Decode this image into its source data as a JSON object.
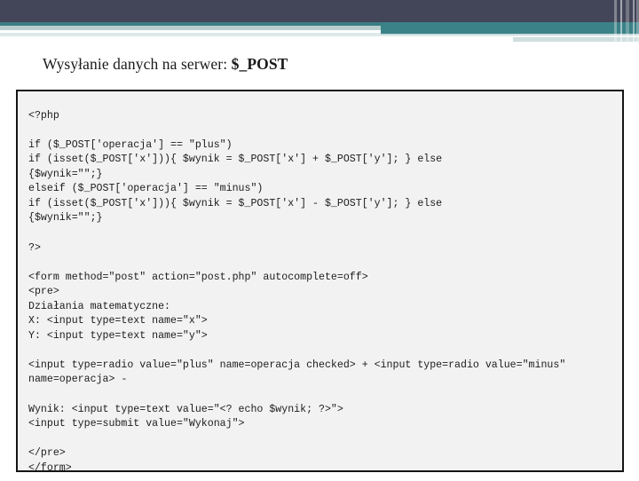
{
  "slide": {
    "title_prefix": "Wysyłanie danych na serwer: ",
    "title_accent": "$_POST",
    "theme": {
      "header_navy": "#434559",
      "header_teal": "#3b8288",
      "header_pale": "#b9cdcd",
      "code_background": "#f2f2f2",
      "code_border": "#151515",
      "code_text": "#1c1c1c",
      "slide_background": "#ffffff"
    }
  },
  "code_block": {
    "language": "php",
    "content": "<?php\n\nif ($_POST['operacja'] == \"plus\")\nif (isset($_POST['x'])){ $wynik = $_POST['x'] + $_POST['y']; } else\n{$wynik=\"\";}\nelseif ($_POST['operacja'] == \"minus\")\nif (isset($_POST['x'])){ $wynik = $_POST['x'] - $_POST['y']; } else\n{$wynik=\"\";}\n\n?>\n\n<form method=\"post\" action=\"post.php\" autocomplete=off>\n<pre>\nDziałania matematyczne:\nX: <input type=text name=\"x\">\nY: <input type=text name=\"y\">\n\n<input type=radio value=\"plus\" name=operacja checked> + <input type=radio value=\"minus\" name=operacja> -\n\nWynik: <input type=text value=\"<? echo $wynik; ?>\">\n<input type=submit value=\"Wykonaj\">\n\n</pre>\n</form>",
    "lines": [
      "<?php",
      "",
      "if ($_POST['operacja'] == \"plus\")",
      "if (isset($_POST['x'])){ $wynik = $_POST['x'] + $_POST['y']; } else",
      "{$wynik=\"\";}",
      "elseif ($_POST['operacja'] == \"minus\")",
      "if (isset($_POST['x'])){ $wynik = $_POST['x'] - $_POST['y']; } else",
      "{$wynik=\"\";}",
      "",
      "?>",
      "",
      "<form method=\"post\" action=\"post.php\" autocomplete=off>",
      "<pre>",
      "Działania matematyczne:",
      "X: <input type=text name=\"x\">",
      "Y: <input type=text name=\"y\">",
      "",
      "<input type=radio value=\"plus\" name=operacja checked> + <input type=radio value=\"minus\" name=operacja> -",
      "",
      "Wynik: <input type=text value=\"<? echo $wynik; ?>\">",
      "<input type=submit value=\"Wykonaj\">",
      "",
      "</pre>",
      "</form>"
    ]
  }
}
